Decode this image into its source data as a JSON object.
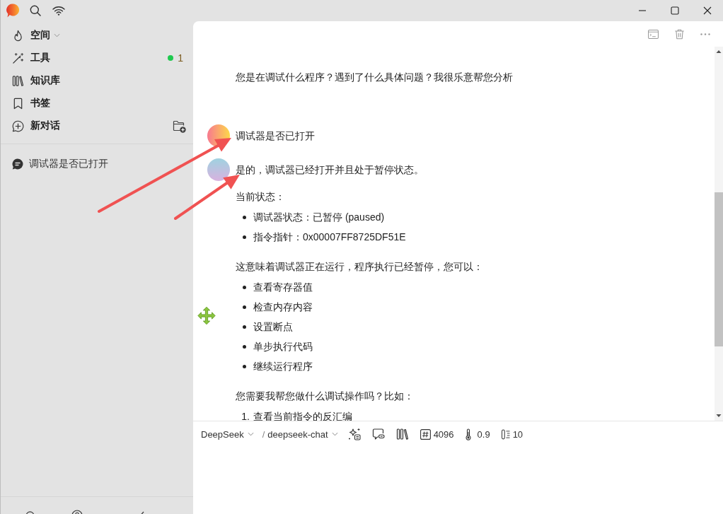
{
  "sidebar": {
    "nav": [
      {
        "kind": "menu",
        "label": "空间"
      },
      {
        "kind": "counter",
        "label": "工具",
        "count": "1"
      },
      {
        "kind": "link",
        "label": "知识库"
      },
      {
        "kind": "link",
        "label": "书签"
      },
      {
        "kind": "action",
        "label": "新对话"
      }
    ],
    "conversations": [
      {
        "title": "调试器是否已打开",
        "selected": false
      }
    ]
  },
  "chat": {
    "messages": [
      {
        "kind": "continuation",
        "blocks": [
          {
            "kind": "paragraph",
            "text": "您是在调试什么程序？遇到了什么具体问题？我很乐意帮您分析"
          }
        ]
      },
      {
        "kind": "user",
        "blocks": [
          {
            "kind": "paragraph",
            "text": "调试器是否已打开"
          }
        ]
      },
      {
        "kind": "assistant",
        "blocks": [
          {
            "kind": "paragraph",
            "text": "是的，调试器已经打开并且处于暂停状态。"
          },
          {
            "kind": "paragraph",
            "text": "当前状态："
          },
          {
            "kind": "bullets",
            "items": [
              "调试器状态：已暂停 (paused)",
              "指令指针：0x00007FF8725DF51E"
            ]
          },
          {
            "kind": "paragraph",
            "text": "这意味着调试器正在运行，程序执行已经暂停，您可以："
          },
          {
            "kind": "bullets",
            "items": [
              "查看寄存器值",
              "检查内存内容",
              "设置断点",
              "单步执行代码",
              "继续运行程序"
            ]
          },
          {
            "kind": "paragraph",
            "text": "您需要我帮您做什么调试操作吗？比如："
          },
          {
            "kind": "numbered",
            "items": [
              {
                "number": "1.",
                "text": "查看当前指令的反汇编"
              }
            ]
          }
        ]
      }
    ]
  },
  "composer": {
    "provider": "DeepSeek",
    "separator": "/",
    "model": "deepseek-chat",
    "max_tokens": "4096",
    "temperature": "0.9",
    "context_count": "10"
  }
}
